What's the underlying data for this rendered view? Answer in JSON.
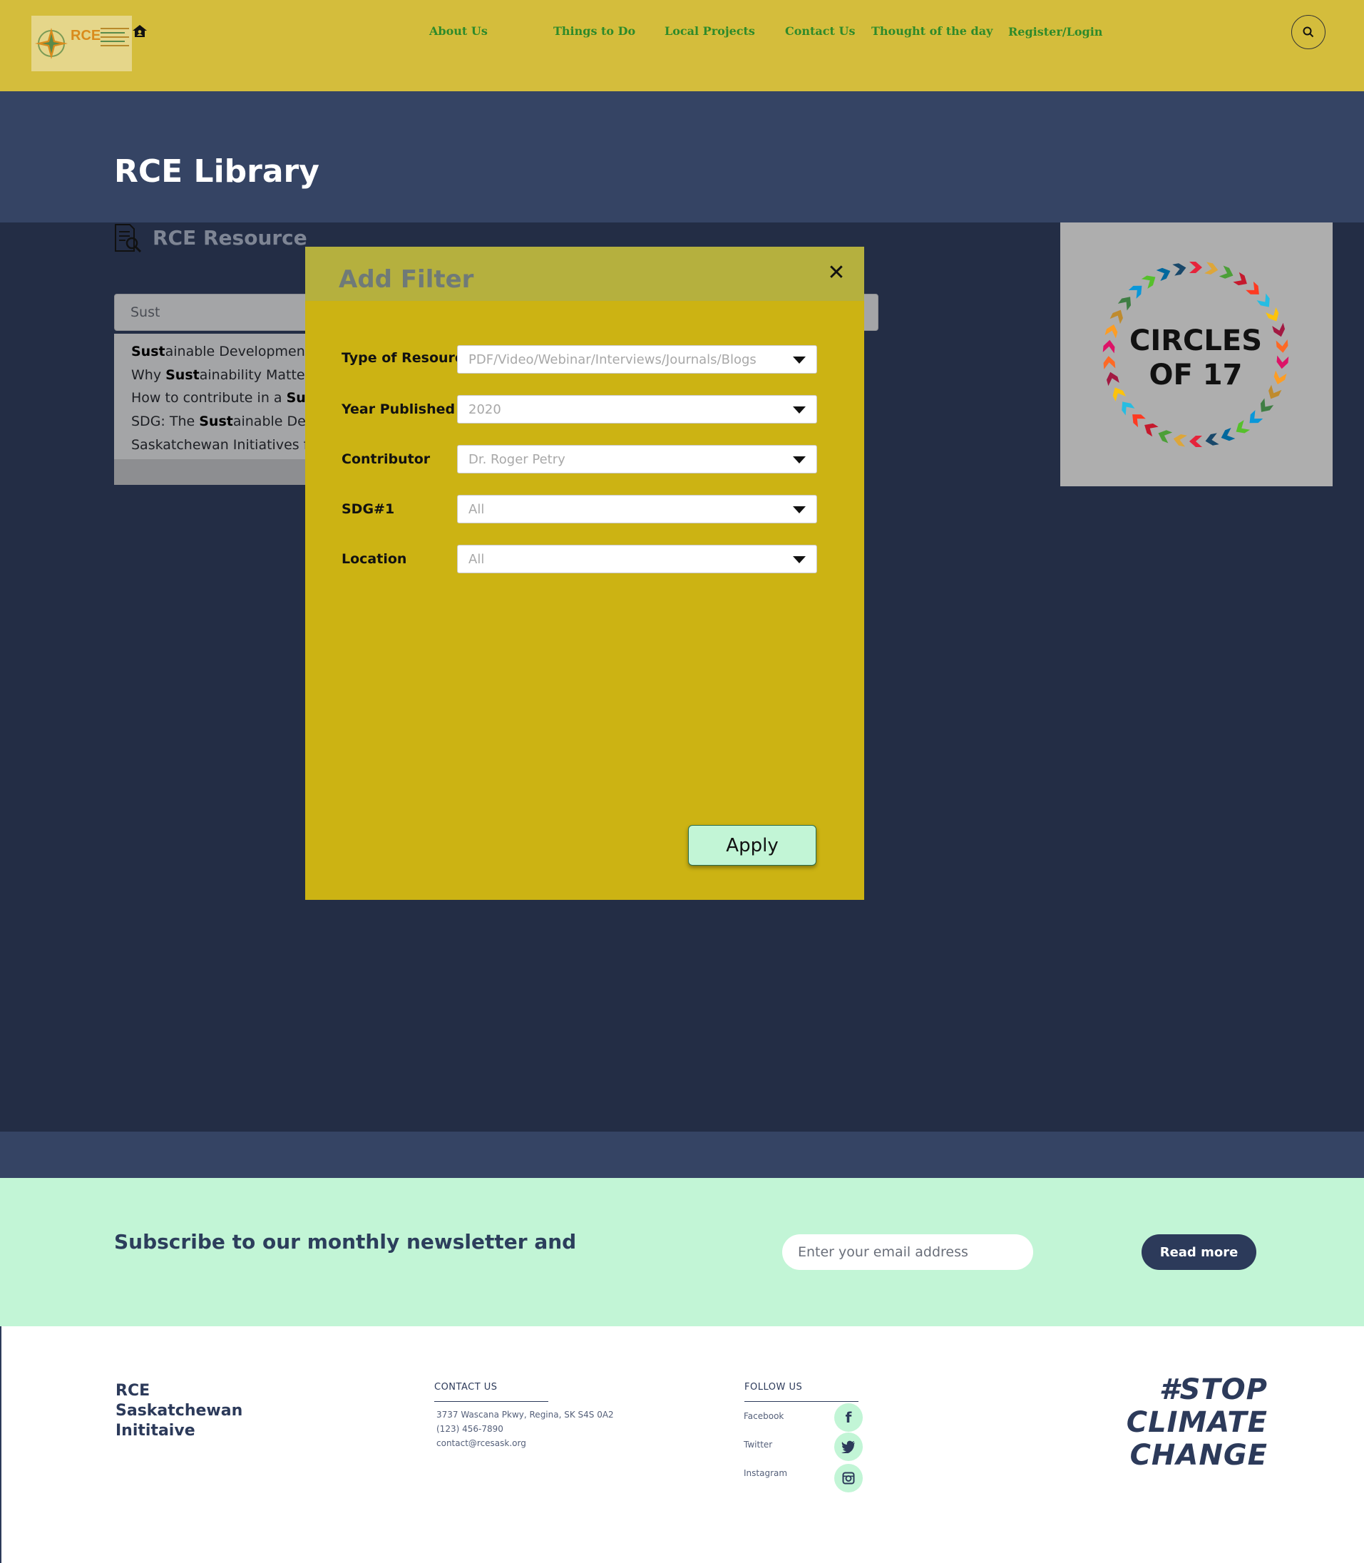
{
  "header": {
    "logo_text": "RCE",
    "nav": [
      "About Us",
      "Things to Do",
      "Local Projects",
      "Contact Us",
      "Thought of the day",
      "Register/Login"
    ]
  },
  "hero": {
    "title": "RCE Library"
  },
  "content": {
    "section_title": "RCE Resource",
    "search_value": "Sust",
    "suggestions": [
      {
        "bold": "Sust",
        "rest": "ainable Development",
        "prefix": ""
      },
      {
        "prefix": "Why ",
        "bold": "Sust",
        "rest": "ainability Matters"
      },
      {
        "prefix": "How to contribute in a ",
        "bold": "Sust",
        "rest": ""
      },
      {
        "prefix": "SDG: The ",
        "bold": "Sust",
        "rest": "ainable Devel"
      },
      {
        "prefix": "Saskatchewan Initiatives for",
        "bold": "",
        "rest": ""
      }
    ],
    "circles_card": {
      "line1": "CIRCLES",
      "line2": "OF 17"
    }
  },
  "modal": {
    "title": "Add Filter",
    "close_glyph": "✕",
    "filters": [
      {
        "label": "Type of Resource",
        "value": "PDF/Video/Webinar/Interviews/Journals/Blogs"
      },
      {
        "label": "Year Published",
        "value": "2020"
      },
      {
        "label": "Contributor",
        "value": "Dr. Roger Petry"
      },
      {
        "label": "SDG#1",
        "value": "All"
      },
      {
        "label": "Location",
        "value": "All"
      }
    ],
    "apply_label": "Apply"
  },
  "newsletter": {
    "title": "Subscribe to our monthly newsletter and",
    "email_placeholder": "Enter your email address",
    "button_label": "Read more"
  },
  "footer": {
    "org_name": "RCE Saskatchewan Inititaive",
    "contact": {
      "heading": "CONTACT US",
      "address": "3737 Wascana Pkwy, Regina, SK S4S 0A2",
      "phone": "(123) 456-7890",
      "email": "contact@rcesask.org"
    },
    "follow": {
      "heading": "FOLLOW US",
      "items": [
        {
          "label": "Facebook",
          "icon": "facebook-icon"
        },
        {
          "label": "Twitter",
          "icon": "twitter-icon"
        },
        {
          "label": "Instagram",
          "icon": "instagram-icon"
        }
      ]
    },
    "slogan": [
      "#STOP",
      "CLIMATE",
      "CHANGE"
    ]
  },
  "colors": {
    "header_bg": "#d4bd3c",
    "hero_bg": "#354464",
    "overlay_bg": "#232d45",
    "modal_bg": "#ccb313",
    "accent_mint": "#c2f5d6",
    "navy": "#2c3a5a"
  }
}
